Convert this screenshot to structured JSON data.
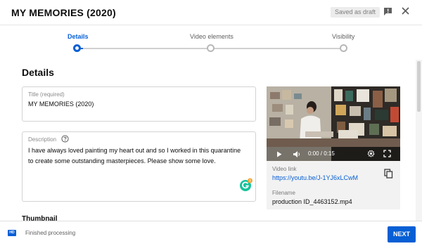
{
  "dialog": {
    "title": "MY MEMORIES (2020)",
    "saved_status": "Saved as draft",
    "icons": {
      "feedback": "feedback-icon",
      "close": "close-icon"
    }
  },
  "steps": [
    {
      "label": "Details",
      "active": true
    },
    {
      "label": "Video elements",
      "active": false
    },
    {
      "label": "Visibility",
      "active": false
    }
  ],
  "form": {
    "section_title": "Details",
    "title_field": {
      "label": "Title (required)",
      "value": "MY MEMORIES (2020)"
    },
    "description_field": {
      "label": "Description",
      "value": "I have always loved painting my heart out and so I worked in this quarantine to create some outstanding masterpieces. Please show some love."
    },
    "thumbnail_label": "Thumbnail"
  },
  "video": {
    "time": "0:00 / 0:15",
    "link_label": "Video link",
    "link": "https://youtu.be/J-1YJ6xLCwM",
    "filename_label": "Filename",
    "filename": "production ID_4463152.mp4",
    "progress": 0
  },
  "footer": {
    "badge": "HD",
    "status": "Finished processing",
    "next_label": "NEXT"
  },
  "colors": {
    "accent": "#065fd4",
    "grammarly": "#15c39a"
  }
}
